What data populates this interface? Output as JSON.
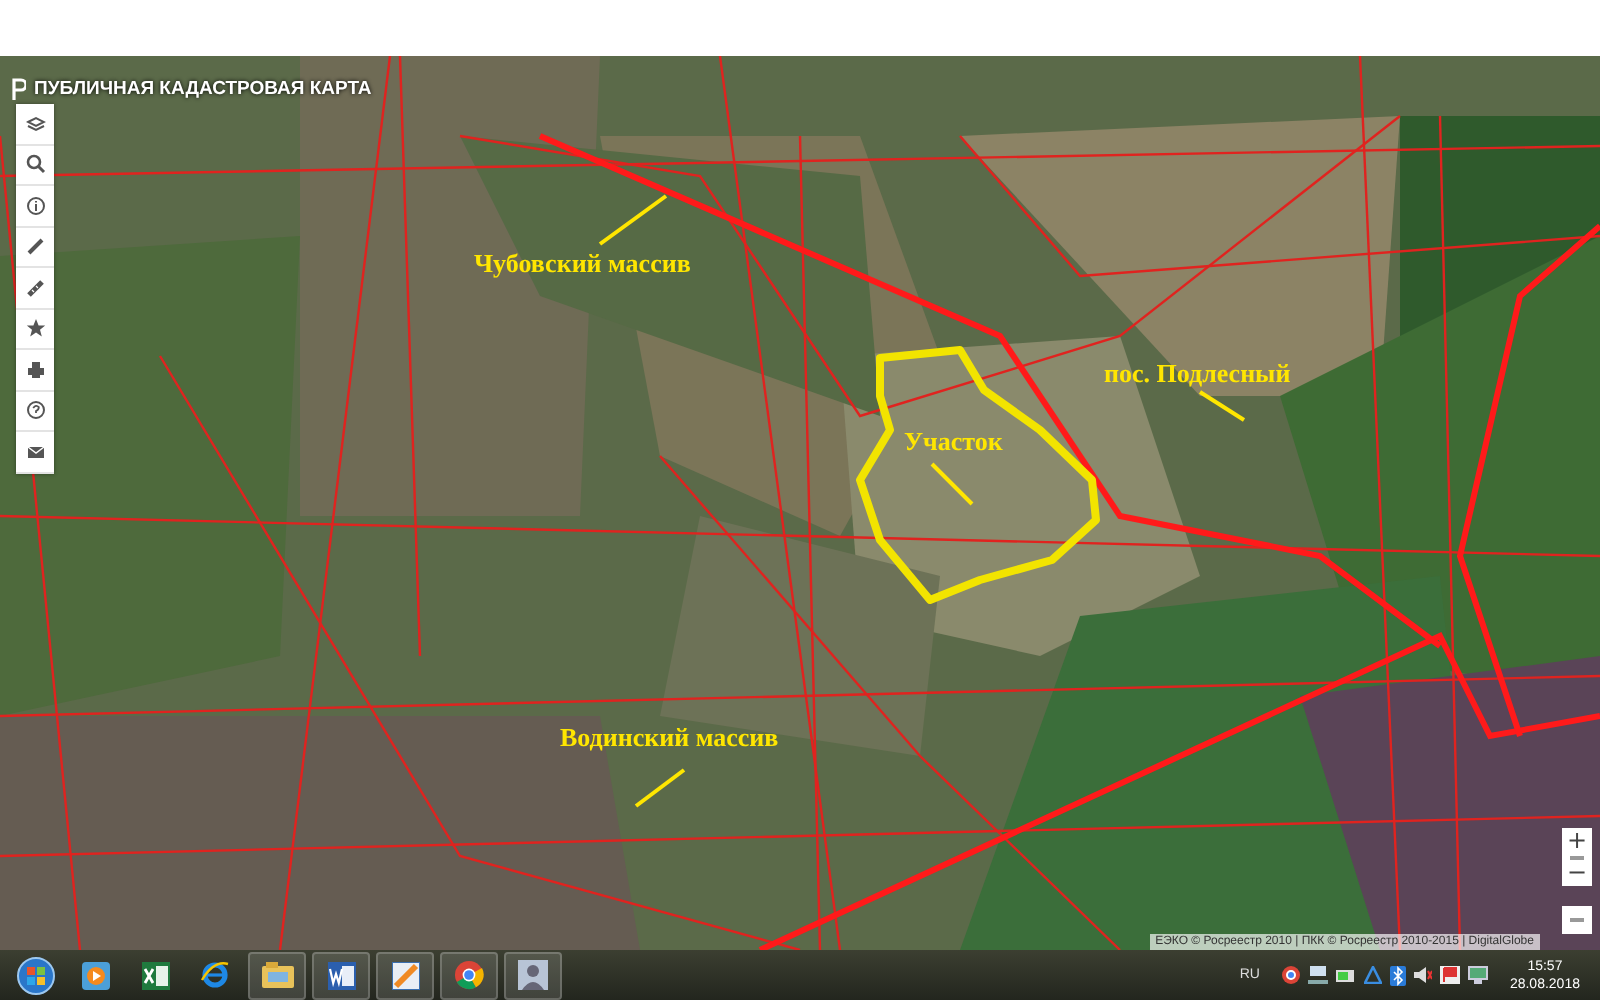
{
  "header": {
    "title": "ПУБЛИЧНАЯ КАДАСТРОВАЯ КАРТА"
  },
  "annotations": [
    {
      "text": "Чубовский массив"
    },
    {
      "text": "Участок"
    },
    {
      "text": "пос. Подлесный"
    },
    {
      "text": "Водинский массив"
    }
  ],
  "zoom": {
    "plus": "+",
    "minus": "−"
  },
  "attribution": "ЕЭКО © Росреестр 2010 | ПКК © Росреестр 2010-2015 | DigitalGlobe",
  "taskbar": {
    "language": "RU",
    "time": "15:57",
    "date": "28.08.2018"
  }
}
